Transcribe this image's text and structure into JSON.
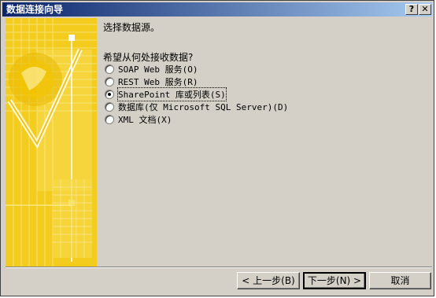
{
  "window": {
    "title": "数据连接向导",
    "help_label": "?",
    "close_label": "✕"
  },
  "main": {
    "heading": "选择数据源。",
    "question": "希望从何处接收数据?",
    "options": [
      {
        "label": "SOAP Web 服务(O)",
        "selected": false
      },
      {
        "label": "REST Web 服务(R)",
        "selected": false
      },
      {
        "label": "SharePoint 库或列表(S)",
        "selected": true
      },
      {
        "label": "数据库(仅 Microsoft SQL Server)(D)",
        "selected": false
      },
      {
        "label": "XML 文档(X)",
        "selected": false
      }
    ]
  },
  "buttons": {
    "back": "< 上一步(B)",
    "next": "下一步(N) >",
    "cancel": "取消"
  },
  "colors": {
    "title_start": "#0a246a",
    "title_end": "#a6caf0",
    "banner": "#f3cc1e",
    "dialog_bg": "#d4d0c8"
  }
}
